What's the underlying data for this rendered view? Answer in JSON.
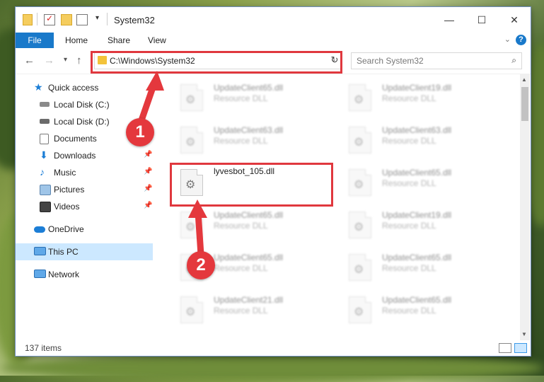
{
  "window": {
    "title": "System32",
    "minimize_icon": "minimize-icon",
    "maximize_icon": "maximize-icon",
    "close_icon": "close-icon"
  },
  "ribbon": {
    "file_label": "File",
    "tabs": [
      "Home",
      "Share",
      "View"
    ],
    "help_label": "?"
  },
  "nav": {
    "address": "C:\\Windows\\System32",
    "search_placeholder": "Search System32"
  },
  "sidebar": {
    "items": [
      {
        "label": "Quick access",
        "icon": "star-icon",
        "pinned": false
      },
      {
        "label": "Local Disk (C:)",
        "icon": "drive-icon",
        "pinned": false
      },
      {
        "label": "Local Disk (D:)",
        "icon": "drive-icon",
        "pinned": false
      },
      {
        "label": "Documents",
        "icon": "documents-icon",
        "pinned": true
      },
      {
        "label": "Downloads",
        "icon": "downloads-icon",
        "pinned": true
      },
      {
        "label": "Music",
        "icon": "music-icon",
        "pinned": true
      },
      {
        "label": "Pictures",
        "icon": "pictures-icon",
        "pinned": true
      },
      {
        "label": "Videos",
        "icon": "videos-icon",
        "pinned": true
      },
      {
        "label": "OneDrive",
        "icon": "cloud-icon",
        "pinned": false
      },
      {
        "label": "This PC",
        "icon": "computer-icon",
        "pinned": false,
        "selected": true
      },
      {
        "label": "Network",
        "icon": "network-icon",
        "pinned": false
      }
    ]
  },
  "files": [
    {
      "name": "UpdateClient65.dll",
      "type": "Resource DLL",
      "blurred": true
    },
    {
      "name": "UpdateClient19.dll",
      "type": "Resource DLL",
      "blurred": true
    },
    {
      "name": "UpdateClient63.dll",
      "type": "Resource DLL",
      "blurred": true
    },
    {
      "name": "UpdateClient63.dll",
      "type": "Resource DLL",
      "blurred": true
    },
    {
      "name": "lyvesbot_105.dll",
      "type": "",
      "blurred": false
    },
    {
      "name": "UpdateClient65.dll",
      "type": "Resource DLL",
      "blurred": true
    },
    {
      "name": "UpdateClient65.dll",
      "type": "Resource DLL",
      "blurred": true
    },
    {
      "name": "UpdateClient19.dll",
      "type": "Resource DLL",
      "blurred": true
    },
    {
      "name": "UpdateClient65.dll",
      "type": "Resource DLL",
      "blurred": true
    },
    {
      "name": "UpdateClient65.dll",
      "type": "Resource DLL",
      "blurred": true
    },
    {
      "name": "UpdateClient21.dll",
      "type": "Resource DLL",
      "blurred": true
    },
    {
      "name": "UpdateClient65.dll",
      "type": "Resource DLL",
      "blurred": true
    }
  ],
  "status": {
    "item_count": "137 items"
  },
  "annotations": {
    "badge1": "1",
    "badge2": "2",
    "color": "#e0383e"
  }
}
